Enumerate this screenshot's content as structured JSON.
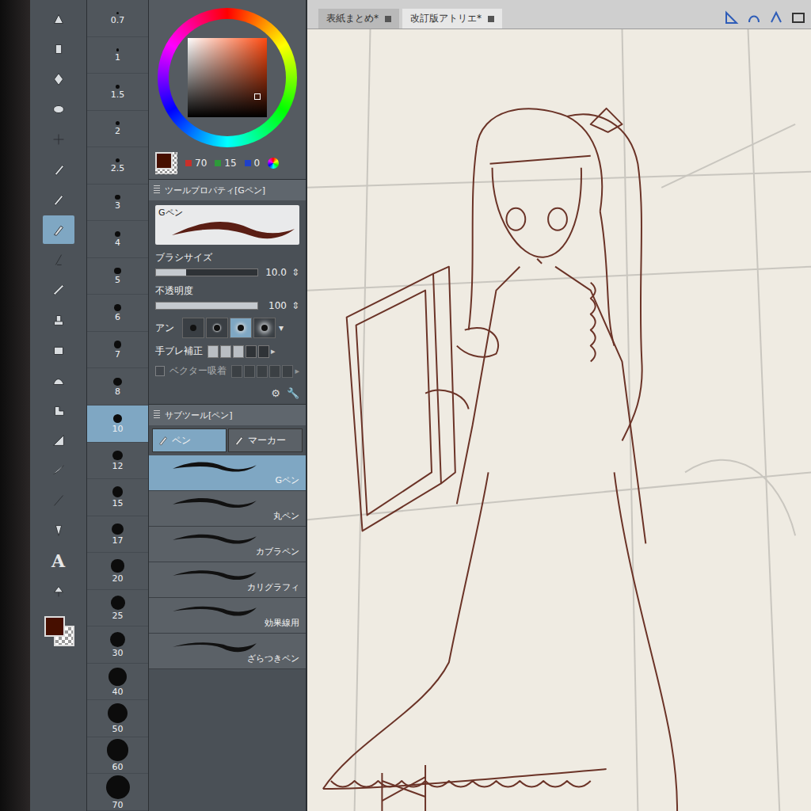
{
  "document_tabs": [
    {
      "label": "表紙まとめ*",
      "selected": false
    },
    {
      "label": "改訂版アトリエ*",
      "selected": true
    }
  ],
  "tools": [
    {
      "glyph": "",
      "selected": false
    },
    {
      "glyph": "",
      "selected": false
    },
    {
      "glyph": "",
      "selected": false
    },
    {
      "glyph": "",
      "selected": false
    },
    {
      "glyph": "",
      "selected": false
    },
    {
      "glyph": "",
      "selected": false
    },
    {
      "glyph": "",
      "selected": false
    },
    {
      "glyph": "",
      "selected": true
    },
    {
      "glyph": "",
      "selected": false
    },
    {
      "glyph": "",
      "selected": false
    },
    {
      "glyph": "",
      "selected": false
    },
    {
      "glyph": "",
      "selected": false
    },
    {
      "glyph": "",
      "selected": false
    },
    {
      "glyph": "",
      "selected": false
    },
    {
      "glyph": "",
      "selected": false
    },
    {
      "glyph": "",
      "selected": false
    },
    {
      "glyph": "",
      "selected": false
    },
    {
      "glyph": "",
      "selected": false
    },
    {
      "glyph": "A",
      "selected": false
    },
    {
      "glyph": "",
      "selected": false
    }
  ],
  "main_color": "#460f00",
  "brush_sizes": [
    {
      "value": "0.7",
      "selected": false
    },
    {
      "value": "1",
      "selected": false
    },
    {
      "value": "1.5",
      "selected": false
    },
    {
      "value": "2",
      "selected": false
    },
    {
      "value": "2.5",
      "selected": false
    },
    {
      "value": "3",
      "selected": false
    },
    {
      "value": "4",
      "selected": false
    },
    {
      "value": "5",
      "selected": false
    },
    {
      "value": "6",
      "selected": false
    },
    {
      "value": "7",
      "selected": false
    },
    {
      "value": "8",
      "selected": false
    },
    {
      "value": "10",
      "selected": true
    },
    {
      "value": "12",
      "selected": false
    },
    {
      "value": "15",
      "selected": false
    },
    {
      "value": "17",
      "selected": false
    },
    {
      "value": "20",
      "selected": false
    },
    {
      "value": "25",
      "selected": false
    },
    {
      "value": "30",
      "selected": false
    },
    {
      "value": "40",
      "selected": false
    },
    {
      "value": "50",
      "selected": false
    },
    {
      "value": "60",
      "selected": false
    },
    {
      "value": "70",
      "selected": false
    }
  ],
  "rgb": [
    {
      "value": "70",
      "color": "#c8302a"
    },
    {
      "value": "15",
      "color": "#2e9a3a"
    },
    {
      "value": "0",
      "color": "#2040c8"
    }
  ],
  "tool_property": {
    "title": "ツールプロパティ[Gペン]",
    "preview_label": "Gペン",
    "brush_size": {
      "label": "ブラシサイズ",
      "value": "10.0",
      "level": 0.3
    },
    "opacity": {
      "label": "不透明度",
      "value": "100",
      "level": 1
    },
    "antialias": {
      "label": "アン",
      "options": [
        {
          "selected": false
        },
        {
          "selected": false
        },
        {
          "selected": true
        },
        {
          "selected": false
        }
      ]
    },
    "stabilization": {
      "label": "手ブレ補正",
      "level": 0.6
    },
    "vector": {
      "label": "ベクター吸着",
      "disabled": true,
      "checked": false
    }
  },
  "sub_tool": {
    "title": "サブツール[ペン]",
    "tabs": [
      {
        "label": "ペン",
        "selected": true
      },
      {
        "label": "マーカー",
        "selected": false
      }
    ],
    "items": [
      {
        "label": "Gペン",
        "selected": true
      },
      {
        "label": "丸ペン",
        "selected": false
      },
      {
        "label": "カブラペン",
        "selected": false
      },
      {
        "label": "カリグラフィ",
        "selected": false
      },
      {
        "label": "効果線用",
        "selected": false
      },
      {
        "label": "ざらつきペン",
        "selected": false
      }
    ]
  }
}
